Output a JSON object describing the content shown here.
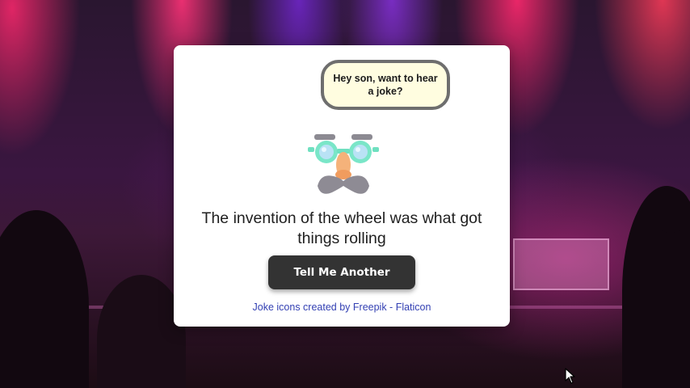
{
  "card": {
    "speech_bubble": "Hey son, want to hear a joke?",
    "joke": "The invention of the wheel was what got things rolling",
    "button_label": "Tell Me Another",
    "credit_link": "Joke icons created by Freepik - Flaticon"
  },
  "icons": {
    "mascot": "disguise-glasses-mustache-icon",
    "cursor": "mouse-pointer-icon"
  },
  "colors": {
    "card_bg": "#ffffff",
    "bubble_bg": "#fffde0",
    "bubble_border": "#6e6e6e",
    "button_bg": "#333333",
    "button_text": "#ffffff",
    "link": "#3340b3"
  }
}
